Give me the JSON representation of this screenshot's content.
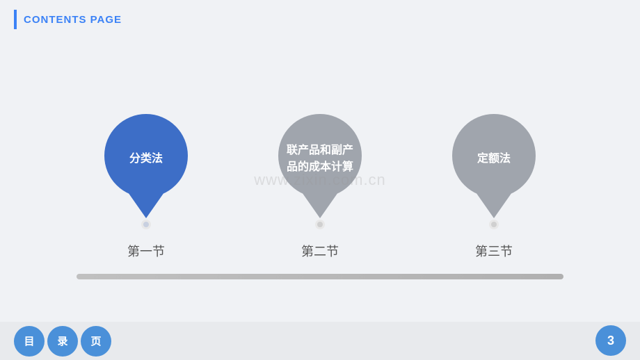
{
  "header": {
    "title": "CONTENTS PAGE",
    "accent_color": "#3b82f6"
  },
  "pins": [
    {
      "id": "pin1",
      "text": "分类法",
      "style": "blue",
      "label": "第一节",
      "multiline": false
    },
    {
      "id": "pin2",
      "text": "联产品和副产\n品的成本计算",
      "style": "gray",
      "label": "第二节",
      "multiline": true
    },
    {
      "id": "pin3",
      "text": "定额法",
      "style": "gray",
      "label": "第三节",
      "multiline": false
    }
  ],
  "watermark": "www.zixin.com.cn",
  "bottom_tabs": [
    {
      "label": "目"
    },
    {
      "label": "录"
    },
    {
      "label": "页"
    }
  ],
  "page_number": "3"
}
